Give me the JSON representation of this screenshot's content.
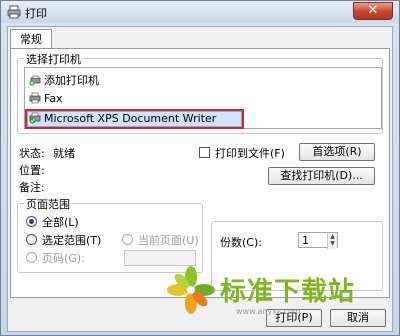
{
  "window": {
    "title": "打印",
    "close_glyph": "✕"
  },
  "tabs": [
    {
      "label": "常规"
    }
  ],
  "select_printer": {
    "legend": "选择打印机",
    "items": [
      {
        "label": "添加打印机",
        "icon": "add-printer-icon"
      },
      {
        "label": "Fax",
        "icon": "fax-printer-icon"
      },
      {
        "label": "Microsoft XPS Document Writer",
        "icon": "printer-check-icon",
        "selected": true
      }
    ]
  },
  "status": {
    "status_label": "状态:",
    "status_value": "就绪",
    "location_label": "位置:",
    "comment_label": "备注:"
  },
  "print_to_file_label": "打印到文件(F)",
  "preferences_button": "首选项(R)",
  "find_printer_button": "查找打印机(D)...",
  "page_range": {
    "legend": "页面范围",
    "all_label": "全部(L)",
    "selection_label": "选定范围(T)",
    "current_page_label": "当前页面(U)",
    "pages_label": "页码(G):"
  },
  "copies": {
    "label": "份数(C):",
    "value": "1"
  },
  "footer": {
    "print_button": "打印(P)",
    "cancel_button": "取消"
  },
  "watermark": {
    "text": "标准下载站",
    "url": "www.anyxz.com"
  },
  "colors": {
    "red_frame": "#d4242c",
    "title_gradient_top": "#e6eef8",
    "close_red": "#c5452f",
    "watermark_green": "#7fb51d"
  }
}
